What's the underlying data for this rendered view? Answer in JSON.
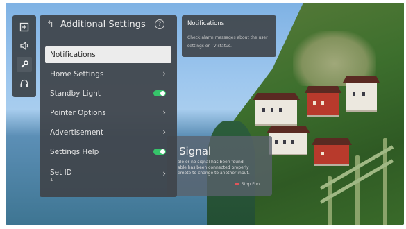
{
  "left_bar": {
    "icons": [
      "input-icon",
      "sound-icon",
      "wrench-icon",
      "headset-icon"
    ],
    "active_index": 2
  },
  "settings_panel": {
    "title": "Additional Settings",
    "back_icon": "back-arrow-icon",
    "help_icon": "help-icon",
    "items": [
      {
        "label": "Notifications",
        "control": "none",
        "selected": true
      },
      {
        "label": "Home Settings",
        "control": "chevron"
      },
      {
        "label": "Standby Light",
        "control": "toggle",
        "on": true
      },
      {
        "label": "Pointer Options",
        "control": "chevron"
      },
      {
        "label": "Advertisement",
        "control": "chevron"
      },
      {
        "label": "Settings Help",
        "control": "toggle",
        "on": true
      },
      {
        "label": "Set ID",
        "sub_value": "1",
        "control": "chevron"
      }
    ]
  },
  "info_panel": {
    "title": "Notifications",
    "description": "Check alarm messages about the user settings or TV status."
  },
  "no_signal_dialog": {
    "title": "Signal",
    "lines": [
      "ale or no signal has been found",
      "able has been connected properly",
      "emote to change to another input."
    ],
    "footer": "Stop Fun"
  },
  "colors": {
    "toggle_on": "#36c46a",
    "panel_bg": "#40454b",
    "selected_bg": "#ececec"
  }
}
